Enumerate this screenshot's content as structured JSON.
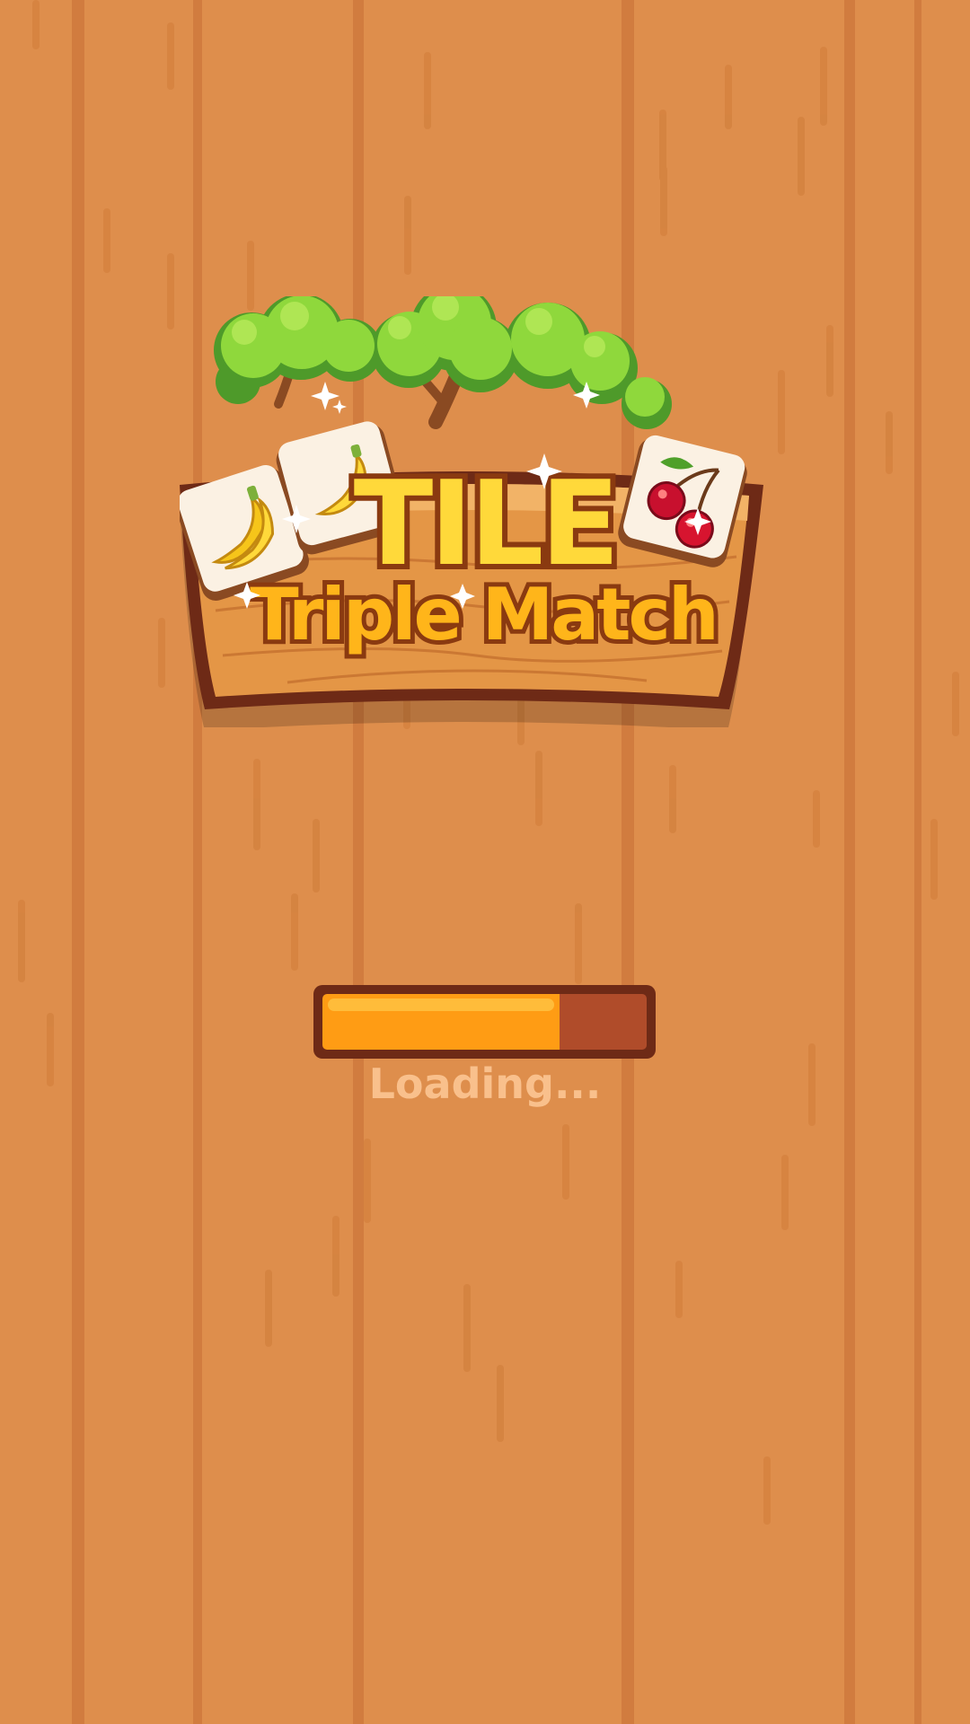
{
  "logo": {
    "title_word": "TILE",
    "subtitle": "Triple Match"
  },
  "tiles": [
    {
      "icon": "banana-icon"
    },
    {
      "icon": "banana-icon"
    },
    {
      "icon": "cherry-icon"
    }
  ],
  "loading": {
    "progress": 0.73,
    "label": "Loading..."
  },
  "colors": {
    "background": "#DE8E4C",
    "plank_stripe": "#CF7A3E",
    "sign_wood": "#E49646",
    "sign_edge": "#6E2A16",
    "title_fill": "#FFD93A",
    "title_outline": "#8A3A10",
    "subtitle_fill": "#FFB51A",
    "bar_fill": "#FF9C14",
    "bar_track": "#B04C2A",
    "loading_text": "#F9C08C"
  }
}
